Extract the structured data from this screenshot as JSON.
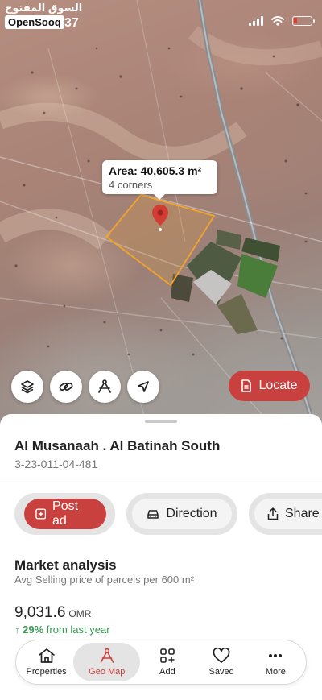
{
  "status_bar": {
    "brand_arabic": "السوق المفتوح",
    "brand_name": "OpenSooq",
    "time_fragment": "37",
    "battery_level": 0.2
  },
  "map": {
    "area_label": "Area: 40,605.3 m²",
    "corners_label": "4 corners",
    "controls": [
      "layers-icon",
      "link-icon",
      "measure-icon",
      "navigate-icon"
    ],
    "locate_label": "Locate"
  },
  "location": {
    "title": "Al Musanaah . Al Batinah South",
    "code": "3-23-011-04-481"
  },
  "actions": {
    "post_ad": "Post ad",
    "direction": "Direction",
    "share": "Share"
  },
  "market": {
    "title": "Market analysis",
    "subtitle": "Avg Selling price of parcels per 600 m²",
    "price": "9,031.6",
    "currency": "OMR",
    "change_arrow": "↑",
    "change_value": "29%",
    "change_text": "from last year"
  },
  "nav": {
    "items": [
      {
        "label": "Properties",
        "icon": "home-icon"
      },
      {
        "label": "Geo Map",
        "icon": "compass-icon"
      },
      {
        "label": "Add",
        "icon": "add-grid-icon"
      },
      {
        "label": "Saved",
        "icon": "heart-icon"
      },
      {
        "label": "More",
        "icon": "more-icon"
      }
    ]
  },
  "colors": {
    "accent": "#c9413e",
    "parcel_outline": "#f2a52c",
    "positive": "#3a9a54"
  }
}
